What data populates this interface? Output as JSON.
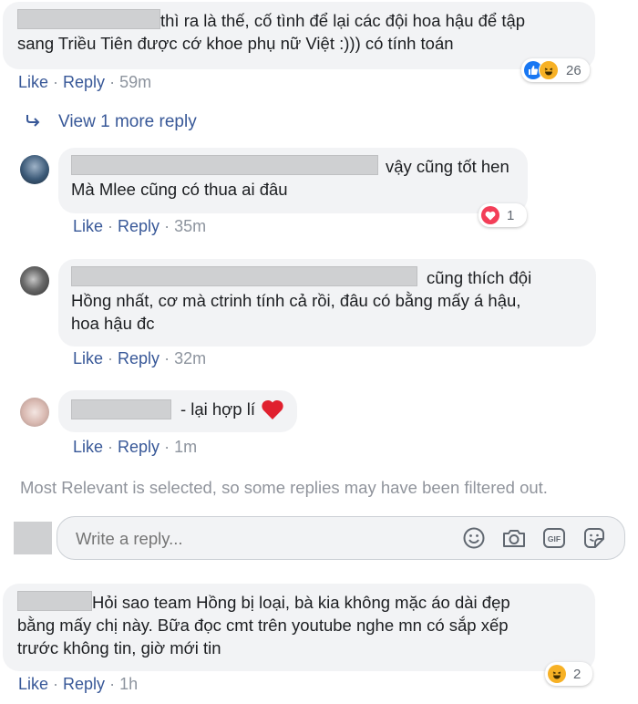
{
  "top_comment": {
    "text": "thì ra là thế, cố tình để lại các đội hoa hậu để tập",
    "text_line2": "sang Triều Tiên được cớ khoe phụ nữ Việt :))) có tính toán",
    "reaction_count": "26",
    "like": "Like",
    "reply": "Reply",
    "time": "59m"
  },
  "view_more": "View 1 more reply",
  "replies": [
    {
      "line1": "vậy cũng tốt hen",
      "line2": "Mà Mlee cũng có thua ai đâu",
      "reaction_count": "1",
      "like": "Like",
      "reply": "Reply",
      "time": "35m"
    },
    {
      "line1": "cũng thích đội",
      "line2": "Hồng nhất, cơ mà ctrinh tính cả rồi, đâu có bằng mấy á hậu,",
      "line3": "hoa hậu đc",
      "like": "Like",
      "reply": "Reply",
      "time": "32m"
    },
    {
      "line1": "- lại hợp lí",
      "like": "Like",
      "reply": "Reply",
      "time": "1m"
    }
  ],
  "filter_note": "Most Relevant is selected, so some replies may have been filtered out.",
  "reply_input": {
    "placeholder": "Write a reply..."
  },
  "bottom_comment": {
    "line1": "Hỏi sao team Hồng bị loại, bà kia không mặc áo dài đẹp",
    "line2": "bằng mấy chị này. Bữa đọc cmt trên youtube nghe mn có sắp xếp",
    "line3": "trước không tin, giờ mới tin",
    "reaction_count": "2",
    "like": "Like",
    "reply": "Reply",
    "time": "1h"
  },
  "colors": {
    "link": "#385898",
    "muted": "#8d949e",
    "bubble": "#f2f3f5",
    "like_blue": "#1877f2",
    "love_red": "#f33e58",
    "haha_yellow": "#f7b125"
  },
  "icons": [
    "reply-arrow-icon",
    "like-reaction-icon",
    "haha-reaction-icon",
    "love-reaction-icon",
    "heart-emoji-icon",
    "emoji-icon",
    "camera-icon",
    "gif-icon",
    "sticker-icon"
  ]
}
